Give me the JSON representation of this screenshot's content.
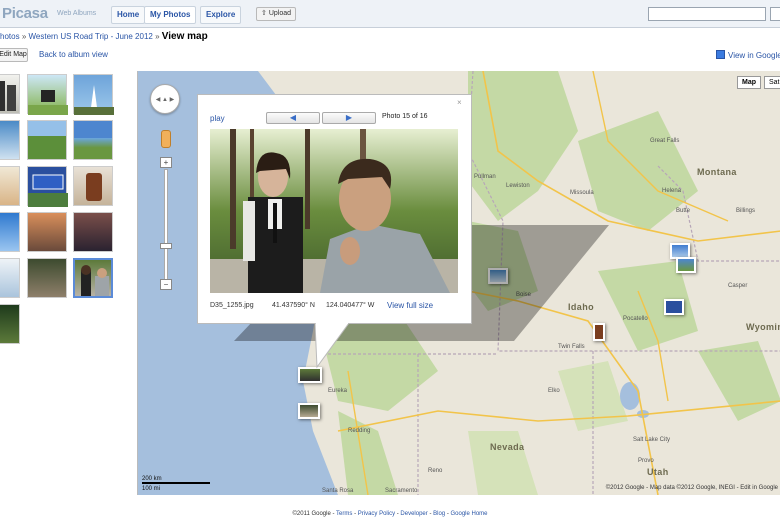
{
  "header": {
    "logo": "Picasa",
    "logo_sub": "Web Albums",
    "tabs": [
      {
        "label": "Home",
        "active": false
      },
      {
        "label": "My Photos",
        "active": true
      },
      {
        "label": "Explore",
        "active": false
      }
    ],
    "upload_label": "Upload"
  },
  "breadcrumb": {
    "items": [
      "hotos",
      "Western US Road Trip - June 2012"
    ],
    "current": "View map"
  },
  "toolbar": {
    "edit_map_label": "Edit Map",
    "back_link": "Back to album view",
    "view_in_google": "View in Google"
  },
  "map": {
    "type_buttons": [
      "Map",
      "Sat"
    ],
    "scale_km": "200 km",
    "scale_mi": "100 mi",
    "copyright": "©2012 Google - Map data ©2012 Google, INEGI - Edit in Google",
    "states": [
      "Montana",
      "Idaho",
      "Wyoming",
      "Nevada",
      "Utah"
    ],
    "cities": [
      "Great Falls",
      "Helena",
      "Pullman",
      "Lewiston",
      "Missoula",
      "Butte",
      "Billings",
      "Boise",
      "Twin Falls",
      "Pocatello",
      "Salt Lake City",
      "Provo",
      "Sacramento",
      "Santa Rosa",
      "Reno",
      "Elko",
      "Casper",
      "Eureka",
      "Redding"
    ]
  },
  "popup": {
    "play_label": "play",
    "prev_symbol": "◀",
    "next_symbol": "▶",
    "close_symbol": "×",
    "counter": "Photo 15 of 16",
    "filename": "D35_1255.jpg",
    "latitude": "41.437590° N",
    "longitude": "124.040477° W",
    "full_size_link": "View full size"
  },
  "footer": {
    "copyright": "©2011 Google",
    "links": [
      "Terms",
      "Privacy Policy",
      "Developer",
      "Blog",
      "Google Home"
    ],
    "separator": "-"
  },
  "colors": {
    "link": "#2a55a6",
    "map_land": "#eae6da",
    "map_water": "#a5bfdd",
    "map_forest": "#c4d9a5",
    "selected_border": "#5b8bd8"
  },
  "icons": [
    "search-icon",
    "upload-icon",
    "pegman-icon",
    "pan-control-icon",
    "close-icon",
    "prev-arrow-icon",
    "next-arrow-icon",
    "google-maps-icon"
  ]
}
